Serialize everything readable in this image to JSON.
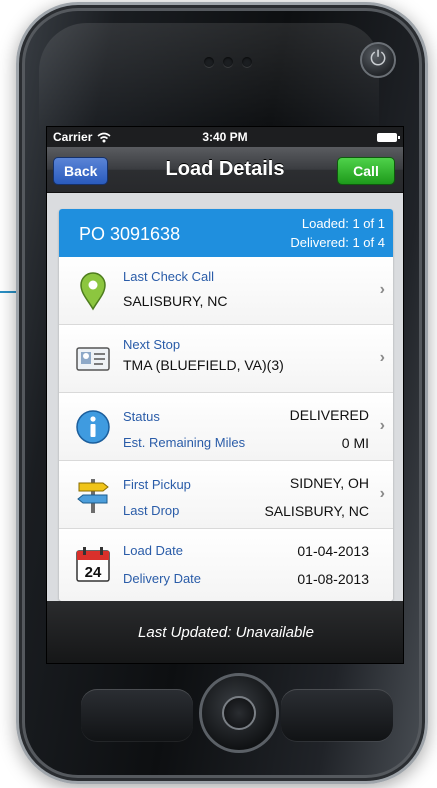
{
  "status_bar": {
    "carrier": "Carrier",
    "time": "3:40 PM"
  },
  "nav": {
    "back": "Back",
    "title": "Load Details",
    "call": "Call"
  },
  "po": {
    "number": "PO 3091638",
    "loaded": "Loaded:  1 of 1",
    "delivered": "Delivered:  1 of 4"
  },
  "rows": {
    "check_call": {
      "label": "Last Check Call",
      "value": "SALISBURY, NC"
    },
    "next_stop": {
      "label": "Next Stop",
      "value": "TMA (BLUEFIELD, VA)(3)"
    },
    "status": {
      "label": "Status",
      "value": "DELIVERED",
      "label2": "Est. Remaining Miles",
      "value2": "0 MI"
    },
    "pickup": {
      "label": "First Pickup",
      "value": "SIDNEY, OH",
      "label2": "Last Drop",
      "value2": "SALISBURY, NC"
    },
    "dates": {
      "label": "Load Date",
      "value": "01-04-2013",
      "label2": "Delivery Date",
      "value2": "01-08-2013",
      "calendar_day": "24"
    }
  },
  "footer": {
    "text": "Last Updated: Unavailable"
  },
  "colors": {
    "accent_blue": "#1f8fde",
    "call_green": "#2fb42c",
    "back_blue": "#3b6fd0",
    "label_blue": "#2a5ca8"
  }
}
